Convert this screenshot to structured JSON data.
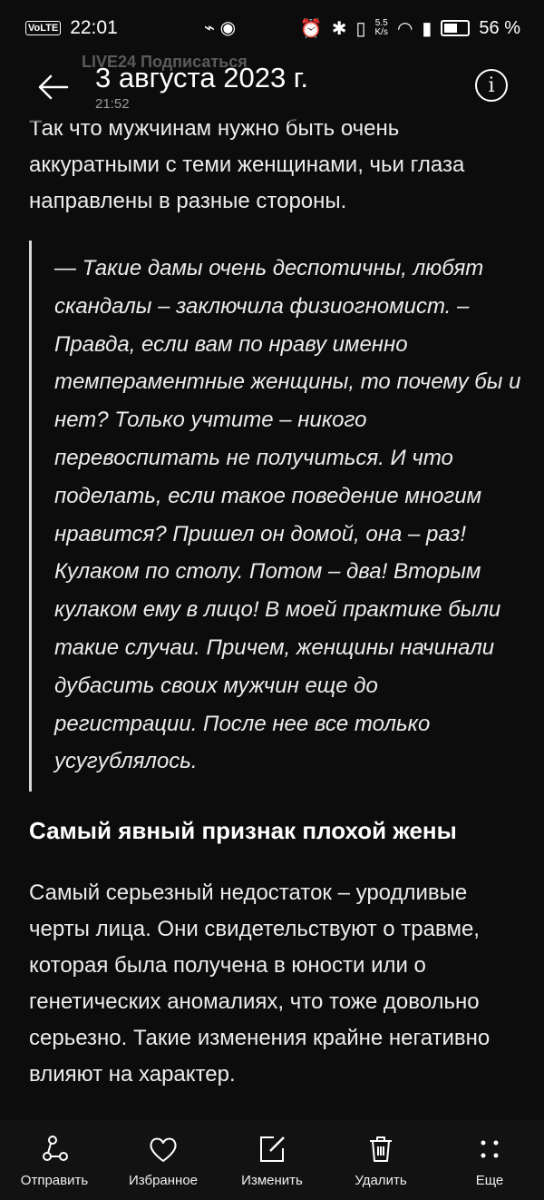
{
  "status_bar": {
    "carrier_badge": "VoLTE",
    "time": "22:01",
    "net_speed_value": "5.5",
    "net_speed_unit": "K/s",
    "battery": "56 %"
  },
  "header": {
    "ghost_text": "LIVE24 Подписаться",
    "title": "3 августа 2023 г.",
    "subtitle_time": "21:52"
  },
  "article": {
    "intro": "Так что мужчинам нужно быть очень аккуратными с теми женщинами, чьи глаза направлены в разные стороны.",
    "quote": "— Такие дамы очень деспотичны, любят скандалы – заключила физиогномист. – Правда, если вам по нраву именно темпераментные женщины, то почему бы и нет? Только учтите – никого перевоспитать не получиться. И что поделать, если такое поведение многим нравится? Пришел он домой, она – раз! Кулаком по столу. Потом – два! Вторым кулаком ему в лицо! В моей практике были такие случаи. Причем, женщины начинали дубасить своих мужчин еще до регистрации. После нее все только усугублялось.",
    "heading": "Самый явный признак плохой жены",
    "paragraph": "Самый серьезный недостаток – уродливые черты лица. Они свидетельствуют о травме, которая была получена в юности или о генетических аномалиях, что тоже довольно серьезно. Такие изменения крайне негативно влияют на характер."
  },
  "bottom_nav": [
    {
      "label": "Отправить",
      "icon": "share-icon"
    },
    {
      "label": "Избранное",
      "icon": "heart-icon"
    },
    {
      "label": "Изменить",
      "icon": "edit-icon"
    },
    {
      "label": "Удалить",
      "icon": "trash-icon"
    },
    {
      "label": "Еще",
      "icon": "more-dots-icon"
    }
  ]
}
